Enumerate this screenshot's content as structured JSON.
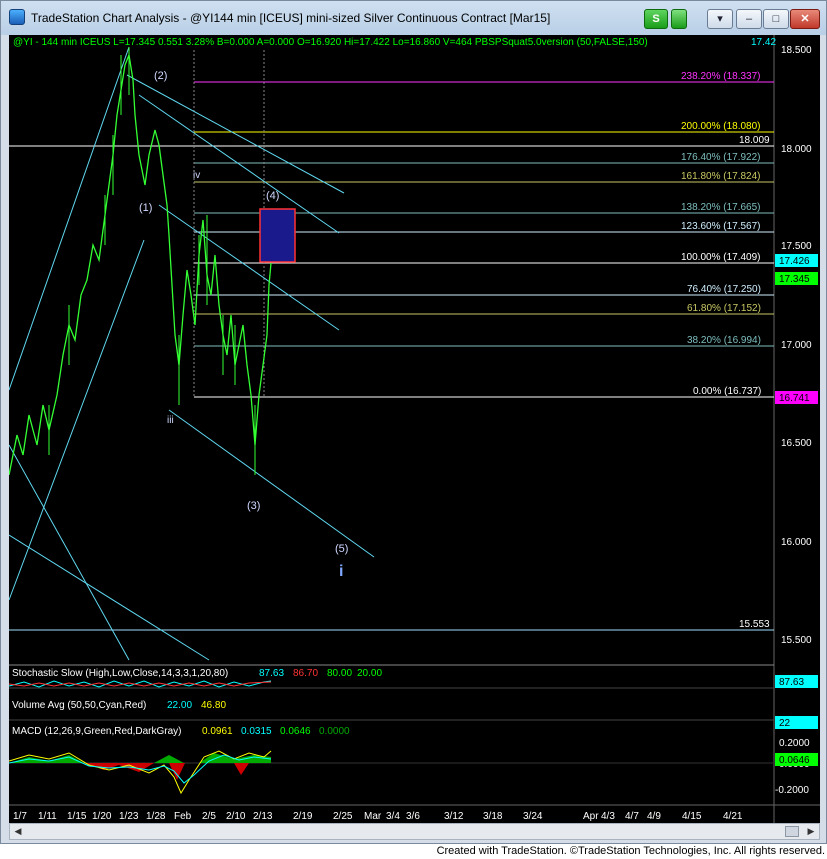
{
  "window": {
    "title": "TradeStation Chart Analysis - @YI144 min [ICEUS] mini-sized Silver Continuous Contract [Mar15]",
    "btn_s": "S",
    "btn_menu": "▾",
    "btn_min": "–",
    "btn_max": "□",
    "btn_close": "✕"
  },
  "header": {
    "symbol_info": "@YI - 144 min  ICEUS  L=17.345  0.551  3.28%  B=0.000  A=0.000  O=16.920  Hi=17.422  Lo=16.860  V=464  PBSPSquat5.0version (50,FALSE,150)",
    "last_value": "17.42"
  },
  "price_axis": {
    "ticks": [
      "18.500",
      "18.000",
      "17.500",
      "17.000",
      "16.500",
      "16.000",
      "15.500"
    ],
    "badges": [
      {
        "value": "17.426",
        "bg": "#00ffff",
        "fg": "#000"
      },
      {
        "value": "17.345",
        "bg": "#00ff00",
        "fg": "#000"
      },
      {
        "value": "16.741",
        "bg": "#ff00ff",
        "fg": "#000"
      }
    ]
  },
  "fib_levels": [
    {
      "label": "238.20% (18.337)",
      "color": "#ff33ff"
    },
    {
      "label": "200.00% (18.080)",
      "color": "#ffff00"
    },
    {
      "label": "18.009",
      "color": "#ffffff"
    },
    {
      "label": "176.40% (17.922)",
      "color": "#7fbfbf"
    },
    {
      "label": "161.80% (17.824)",
      "color": "#c8c864"
    },
    {
      "label": "138.20% (17.665)",
      "color": "#7fbfbf"
    },
    {
      "label": "123.60% (17.567)",
      "color": "#cfefff"
    },
    {
      "label": "100.00% (17.409)",
      "color": "#ffffff"
    },
    {
      "label": "76.40% (17.250)",
      "color": "#cfefff"
    },
    {
      "label": "61.80% (17.152)",
      "color": "#c8c864"
    },
    {
      "label": "38.20% (16.994)",
      "color": "#7fbfbf"
    },
    {
      "label": "0.00% (16.737)",
      "color": "#ffffff"
    },
    {
      "label": "15.553",
      "color": "#ffffff"
    }
  ],
  "wave_labels": [
    "(2)",
    "(1)",
    "iv",
    "(4)",
    "iii",
    "(3)",
    "(5)",
    "i"
  ],
  "stochastic": {
    "label": "Stochastic Slow (High,Low,Close,14,3,3,1,20,80)",
    "values": [
      "87.63",
      "86.70",
      "80.00",
      "20.00"
    ],
    "colors": [
      "#00ffff",
      "#ff3333",
      "#00ff00",
      "#00ff00"
    ],
    "badge": "87.63"
  },
  "volume": {
    "label": "Volume Avg (50,50,Cyan,Red)",
    "values": [
      "22.00",
      "46.80"
    ],
    "colors": [
      "#00ffff",
      "#ffff00"
    ],
    "badge": "22"
  },
  "macd": {
    "label": "MACD (12,26,9,Green,Red,DarkGray)",
    "values": [
      "0.0961",
      "0.0315",
      "0.0646",
      "0.0000"
    ],
    "colors": [
      "#ffff00",
      "#00ffff",
      "#00ff00",
      "#00aa00"
    ],
    "ticks": [
      "0.2000",
      "0.0000",
      "-0.2000"
    ],
    "badge": "0.0646"
  },
  "date_axis": [
    "1/7",
    "1/11",
    "1/15",
    "1/20",
    "1/23",
    "1/28",
    "Feb",
    "2/5",
    "2/10",
    "2/13",
    "2/19",
    "2/25",
    "Mar",
    "3/4",
    "3/6",
    "3/12",
    "3/18",
    "3/24",
    "Apr",
    "4/3",
    "4/7",
    "4/9",
    "4/15",
    "4/21"
  ],
  "footer": "Created with TradeStation. ©TradeStation Technologies, Inc. All rights reserved."
}
